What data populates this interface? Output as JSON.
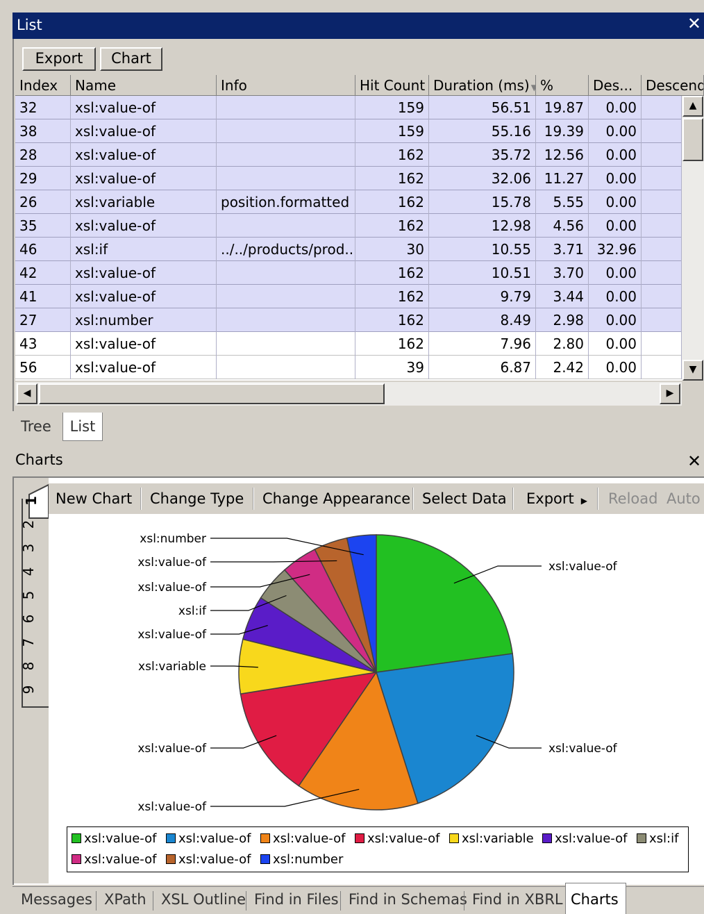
{
  "list_window": {
    "title": "List",
    "toolbar": {
      "export_label": "Export",
      "chart_label": "Chart"
    },
    "columns": [
      "Index",
      "Name",
      "Info",
      "Hit Count",
      "Duration (ms)",
      "%",
      "Des...",
      "Descend"
    ],
    "rows": [
      {
        "index": "32",
        "name": "xsl:value-of",
        "info": "",
        "hits": "159",
        "duration": "56.51",
        "pct": "19.87",
        "des": "0.00",
        "selected": true
      },
      {
        "index": "38",
        "name": "xsl:value-of",
        "info": "",
        "hits": "159",
        "duration": "55.16",
        "pct": "19.39",
        "des": "0.00",
        "selected": true
      },
      {
        "index": "28",
        "name": "xsl:value-of",
        "info": "",
        "hits": "162",
        "duration": "35.72",
        "pct": "12.56",
        "des": "0.00",
        "selected": true
      },
      {
        "index": "29",
        "name": "xsl:value-of",
        "info": "",
        "hits": "162",
        "duration": "32.06",
        "pct": "11.27",
        "des": "0.00",
        "selected": true
      },
      {
        "index": "26",
        "name": "xsl:variable",
        "info": "position.formatted",
        "hits": "162",
        "duration": "15.78",
        "pct": "5.55",
        "des": "0.00",
        "selected": true
      },
      {
        "index": "35",
        "name": "xsl:value-of",
        "info": "",
        "hits": "162",
        "duration": "12.98",
        "pct": "4.56",
        "des": "0.00",
        "selected": true
      },
      {
        "index": "46",
        "name": "xsl:if",
        "info": "../../products/prod...",
        "hits": "30",
        "duration": "10.55",
        "pct": "3.71",
        "des": "32.96",
        "selected": true
      },
      {
        "index": "42",
        "name": "xsl:value-of",
        "info": "",
        "hits": "162",
        "duration": "10.51",
        "pct": "3.70",
        "des": "0.00",
        "selected": true
      },
      {
        "index": "41",
        "name": "xsl:value-of",
        "info": "",
        "hits": "162",
        "duration": "9.79",
        "pct": "3.44",
        "des": "0.00",
        "selected": true
      },
      {
        "index": "27",
        "name": "xsl:number",
        "info": "",
        "hits": "162",
        "duration": "8.49",
        "pct": "2.98",
        "des": "0.00",
        "selected": true
      },
      {
        "index": "43",
        "name": "xsl:value-of",
        "info": "",
        "hits": "162",
        "duration": "7.96",
        "pct": "2.80",
        "des": "0.00",
        "selected": false
      },
      {
        "index": "56",
        "name": "xsl:value-of",
        "info": "",
        "hits": "39",
        "duration": "6.87",
        "pct": "2.42",
        "des": "0.00",
        "selected": false
      }
    ],
    "view_tabs": {
      "tree": "Tree",
      "list": "List"
    }
  },
  "charts_window": {
    "title": "Charts",
    "side_tabs": [
      "1",
      "2",
      "3",
      "4",
      "5",
      "6",
      "7",
      "8",
      "9"
    ],
    "toolbar": {
      "new_chart": "New Chart",
      "change_type": "Change Type",
      "change_appearance": "Change Appearance",
      "select_data": "Select Data",
      "export": "Export",
      "reload": "Reload",
      "auto": "Auto"
    }
  },
  "chart_data": {
    "type": "pie",
    "categories": [
      "xsl:value-of",
      "xsl:value-of",
      "xsl:value-of",
      "xsl:value-of",
      "xsl:variable",
      "xsl:value-of",
      "xsl:if",
      "xsl:value-of",
      "xsl:value-of",
      "xsl:number"
    ],
    "values": [
      56.51,
      55.16,
      35.72,
      32.06,
      15.78,
      12.98,
      10.55,
      10.51,
      9.79,
      8.49
    ],
    "colors": [
      "#22c022",
      "#1a86d0",
      "#f08418",
      "#e01c44",
      "#f8d81c",
      "#5a1cc8",
      "#8c8c74",
      "#d02c84",
      "#b8642c",
      "#1c44f0"
    ],
    "legend": "bottom"
  },
  "bottom_tabs": [
    "Messages",
    "XPath",
    "XSL Outline",
    "Find in Files",
    "Find in Schemas",
    "Find in XBRL",
    "Charts"
  ]
}
